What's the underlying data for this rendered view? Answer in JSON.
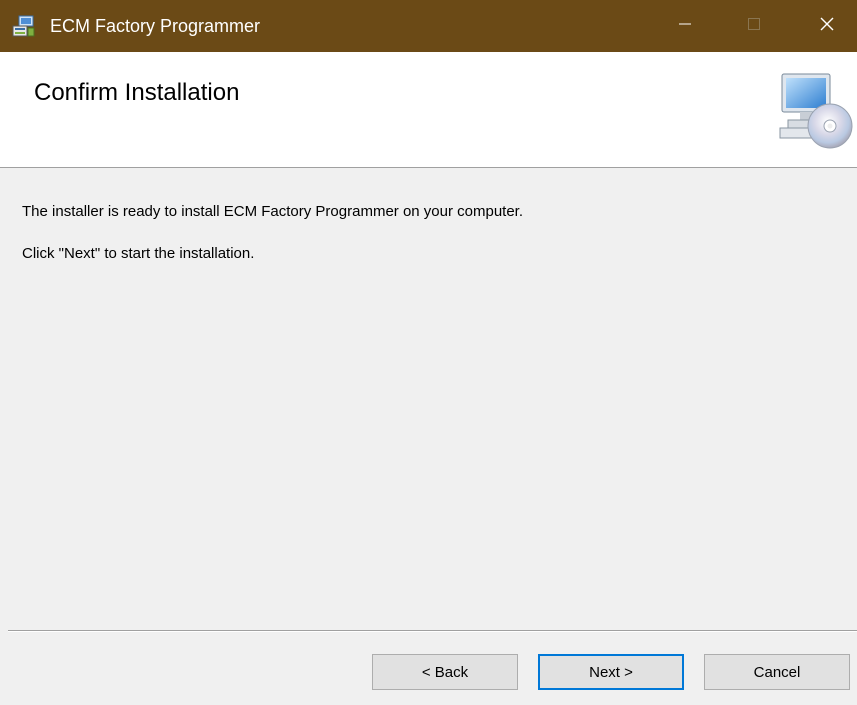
{
  "window": {
    "title": "ECM Factory Programmer",
    "title_bar_color": "#6b4a16",
    "app_icon": "installer-icon"
  },
  "title_controls": {
    "minimize_icon": "minimize-icon",
    "maximize_icon": "maximize-icon",
    "close_icon": "close-icon"
  },
  "header": {
    "title": "Confirm Installation",
    "icon": "computer-cd-icon"
  },
  "body": {
    "line1": "The installer is ready to install ECM Factory Programmer on your computer.",
    "line2": "Click \"Next\" to start the installation."
  },
  "buttons": {
    "back": "< Back",
    "next": "Next >",
    "cancel": "Cancel"
  },
  "colors": {
    "focus_border": "#0078d7",
    "dialog_bg": "#f0f0f0"
  }
}
